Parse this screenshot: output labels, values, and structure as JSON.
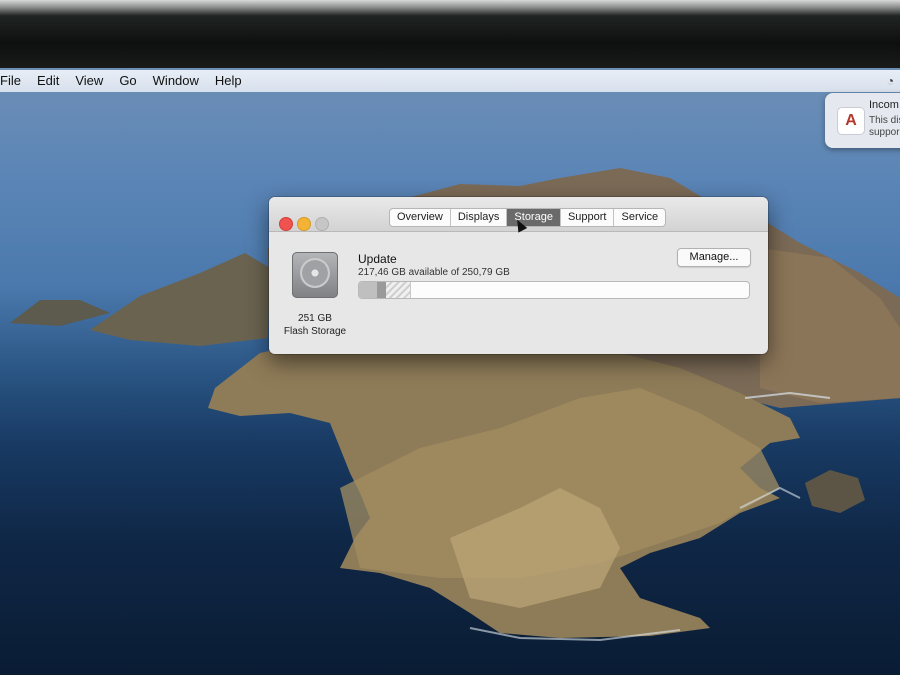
{
  "menubar": {
    "items": [
      "File",
      "Edit",
      "View",
      "Go",
      "Window",
      "Help"
    ]
  },
  "notification": {
    "title": "Incom",
    "body_line1": "This dis",
    "body_line2": "suppor"
  },
  "window": {
    "tabs": [
      {
        "label": "Overview",
        "active": false
      },
      {
        "label": "Displays",
        "active": false
      },
      {
        "label": "Storage",
        "active": true
      },
      {
        "label": "Support",
        "active": false
      },
      {
        "label": "Service",
        "active": false
      }
    ],
    "disk": {
      "capacity": "251 GB",
      "type": "Flash Storage"
    },
    "volume": {
      "name": "Update",
      "availability": "217,46 GB available of 250,79 GB"
    },
    "manage_label": "Manage...",
    "usage_fractions": {
      "other": 0.045,
      "system": 0.025,
      "purgeable": 0.06
    }
  },
  "colors": {
    "close": "#f0524f",
    "minimize": "#f5b335",
    "active_tab": "#6a6a6a"
  }
}
